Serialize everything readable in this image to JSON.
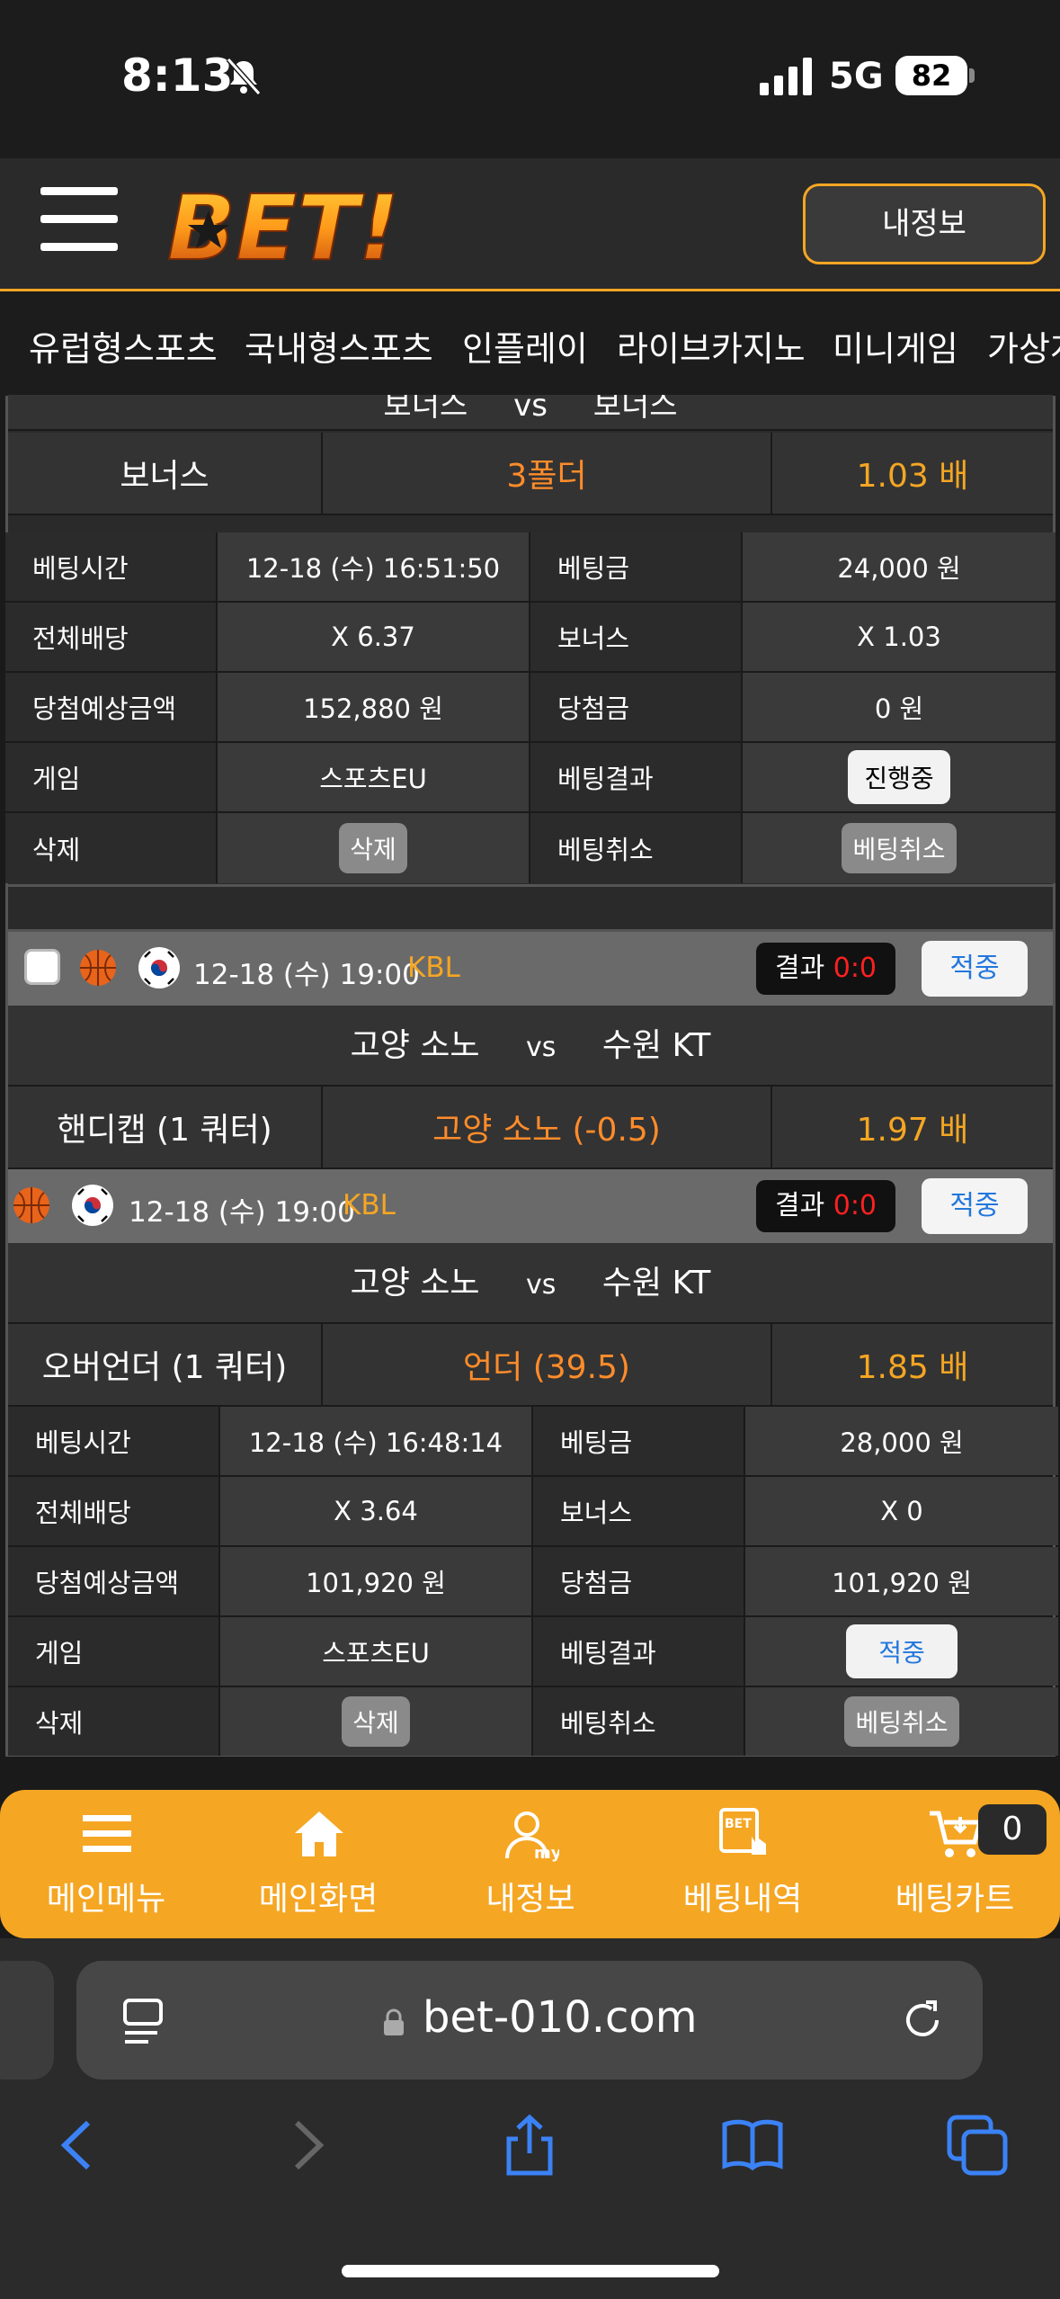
{
  "status": {
    "time": "8:13",
    "network": "5G",
    "battery": "82"
  },
  "header": {
    "myinfo_label": "내정보"
  },
  "nav": {
    "tabs": [
      "유럽형스포츠",
      "국내형스포츠",
      "인플레이",
      "라이브카지노",
      "미니게임",
      "가상게"
    ]
  },
  "bet1": {
    "teams": {
      "home": "보너스",
      "vs": "vs",
      "away": "보너스"
    },
    "pick": {
      "type": "보너스",
      "value": "3폴더",
      "odds": "1.03 배"
    },
    "details": [
      {
        "l1": "베팅시간",
        "v1": "12-18 (수) 16:51:50",
        "l2": "베팅금",
        "v2": "24,000 원"
      },
      {
        "l1": "전체배당",
        "v1": "X 6.37",
        "l2": "보너스",
        "v2": "X 1.03"
      },
      {
        "l1": "당첨예상금액",
        "v1": "152,880 원",
        "l2": "당첨금",
        "v2": "0 원"
      },
      {
        "l1": "게임",
        "v1": "스포츠EU",
        "l2": "베팅결과",
        "v2": "진행중"
      },
      {
        "l1": "삭제",
        "v1": "삭제",
        "l2": "베팅취소",
        "v2": "베팅취소"
      }
    ]
  },
  "bet2": {
    "games": [
      {
        "datetime": "12-18 (수) 19:00",
        "league": "KBL",
        "result_label": "결과",
        "score": "0:0",
        "status": "적중",
        "home": "고양 소노",
        "vs": "vs",
        "away": "수원 KT",
        "market": "핸디캡 (1 쿼터)",
        "pick": "고양 소노 (-0.5)",
        "odds": "1.97 배"
      },
      {
        "datetime": "12-18 (수) 19:00",
        "league": "KBL",
        "result_label": "결과",
        "score": "0:0",
        "status": "적중",
        "home": "고양 소노",
        "vs": "vs",
        "away": "수원 KT",
        "market": "오버언더 (1 쿼터)",
        "pick": "언더 (39.5)",
        "odds": "1.85 배"
      }
    ],
    "details": [
      {
        "l1": "베팅시간",
        "v1": "12-18 (수) 16:48:14",
        "l2": "베팅금",
        "v2": "28,000 원"
      },
      {
        "l1": "전체배당",
        "v1": "X 3.64",
        "l2": "보너스",
        "v2": "X 0"
      },
      {
        "l1": "당첨예상금액",
        "v1": "101,920 원",
        "l2": "당첨금",
        "v2": "101,920 원"
      },
      {
        "l1": "게임",
        "v1": "스포츠EU",
        "l2": "베팅결과",
        "v2": "적중"
      },
      {
        "l1": "삭제",
        "v1": "삭제",
        "l2": "베팅취소",
        "v2": "베팅취소"
      }
    ]
  },
  "bottom_bar": {
    "items": [
      "메인메뉴",
      "메인화면",
      "내정보",
      "베팅내역",
      "베팅카트"
    ],
    "cart_count": "0"
  },
  "browser": {
    "url": "bet-010.com"
  },
  "colors": {
    "accent": "#f5a623",
    "pick_orange": "#ff8c2a",
    "score_red": "#ff2020",
    "hit_blue": "#2277dd"
  }
}
